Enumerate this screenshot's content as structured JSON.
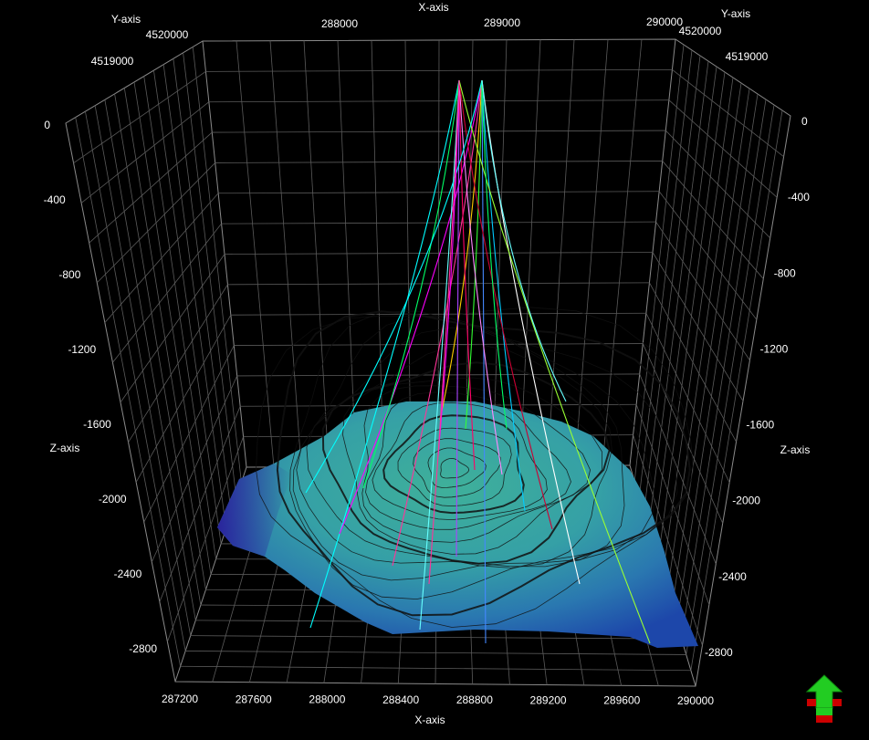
{
  "viewport": {
    "background": "#000000",
    "grid_color": "#5a5a5a",
    "label_color": "#ffffff"
  },
  "axes": {
    "x_title": "X-axis",
    "y_title": "Y-axis",
    "z_title": "Z-axis",
    "x_bottom_ticks": [
      "287200",
      "287600",
      "288000",
      "288400",
      "288800",
      "289200",
      "289600",
      "290000"
    ],
    "x_top_ticks": [
      "288000",
      "289000",
      "290000"
    ],
    "y_ticks": [
      "4520000",
      "4519000"
    ],
    "z_left_ticks": [
      "0",
      "-400",
      "-800",
      "-1200",
      "-1600",
      "-2000",
      "-2400",
      "-2800"
    ],
    "z_right_ticks": [
      "0",
      "-400",
      "-800",
      "-1200",
      "-1600",
      "-2000",
      "-2400",
      "-2800"
    ]
  },
  "surface": {
    "color_top": "#3aa89a",
    "color_mid": "#2f8fa8",
    "color_edge": "#1d4faa",
    "color_low": "#2a1a9a",
    "contour_color": "#111111"
  },
  "wells": {
    "colors": [
      "#00ffff",
      "#ff00ff",
      "#00ff66",
      "#ff3399",
      "#66ffff",
      "#ffcc00",
      "#aa44ff",
      "#33ff33",
      "#ff0066",
      "#4488ff",
      "#ff88ff",
      "#00ccff",
      "#cc0033",
      "#ffffff",
      "#99ff33"
    ]
  },
  "nav_widget": {
    "icon": "navigation-arrow-icon",
    "arrow_color": "#22cc22",
    "base_color": "#cc0000"
  }
}
